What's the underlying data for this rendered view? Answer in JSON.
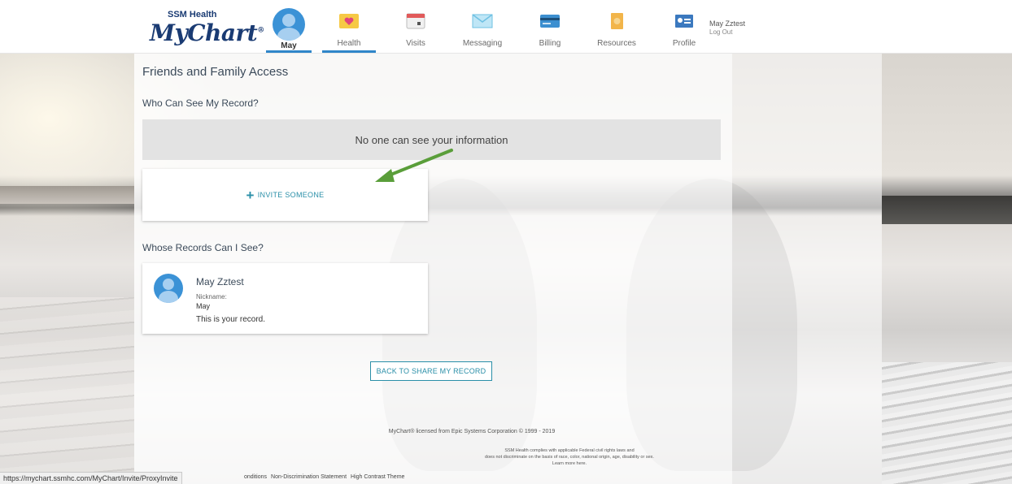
{
  "header": {
    "logo_top": "SSM Health",
    "logo_main": "MyChart",
    "logo_reg": "®",
    "avatar_label": "May",
    "nav": [
      {
        "label": "Health",
        "icon": "health-icon",
        "color": "#f6c945"
      },
      {
        "label": "Visits",
        "icon": "calendar-icon",
        "color": "#e15a5a"
      },
      {
        "label": "Messaging",
        "icon": "envelope-icon",
        "color": "#6fc1e3"
      },
      {
        "label": "Billing",
        "icon": "credit-card-icon",
        "color": "#3c8fd0"
      },
      {
        "label": "Resources",
        "icon": "book-icon",
        "color": "#f2b54a"
      },
      {
        "label": "Profile",
        "icon": "id-card-icon",
        "color": "#3b79bf"
      }
    ],
    "user_name": "May Zztest",
    "logout": "Log Out"
  },
  "main": {
    "page_title": "Friends and Family Access",
    "who_can_see_title": "Who Can See My Record?",
    "empty_message": "No one can see your information",
    "invite_label": "INVITE SOMEONE",
    "whose_records_title": "Whose Records Can I See?",
    "record": {
      "name": "May Zztest",
      "nickname_label": "Nickname:",
      "nickname": "May",
      "note": "This is your record."
    },
    "back_button": "BACK TO SHARE MY RECORD"
  },
  "footer": {
    "license": "MyChart® licensed from Epic Systems Corporation © 1999 - 2019",
    "compliance_1": "SSM Health complies with applicable Federal civil rights laws and",
    "compliance_2": "does not discriminate on the basis of race, color, national origin, age, disability or sex.",
    "compliance_3": "Learn more here.",
    "links": [
      "onditions",
      "Non-Discrimination Statement",
      "High Contrast Theme"
    ]
  },
  "statusbar": {
    "url": "https://mychart.ssmhc.com/MyChart/Invite/ProxyInvite"
  },
  "colors": {
    "accent": "#2f86c9",
    "link": "#2a8fa8",
    "arrow": "#5a9e3a"
  }
}
